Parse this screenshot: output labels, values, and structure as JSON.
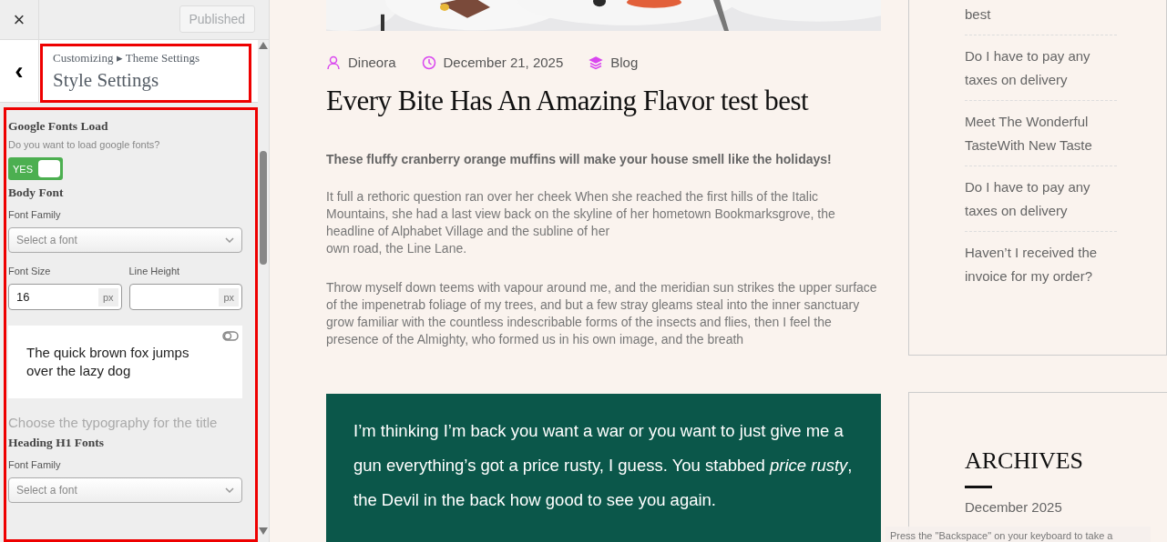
{
  "customizer": {
    "close": "×",
    "publish_button": "Published",
    "breadcrumb": [
      "Customizing",
      "▸",
      "Theme Settings"
    ],
    "back": "‹",
    "title": "Style Settings",
    "sections": [
      {
        "kind": "toggle",
        "heading": "Google Fonts Load",
        "description": "Do you want to load google fonts?",
        "label": "YES",
        "on": true
      },
      {
        "kind": "font",
        "heading": "Body Font",
        "family_label": "Font Family",
        "family_placeholder": "Select a font",
        "size_label": "Font Size",
        "size_value": "16",
        "size_unit": "px",
        "line_label": "Line Height",
        "line_unit": "px",
        "preview": "The quick brown fox jumps over the lazy dog"
      },
      {
        "kind": "note",
        "text": "Choose the typography for the title"
      },
      {
        "kind": "select",
        "heading": "Heading H1 Fonts",
        "family_label": "Font Family",
        "family_placeholder": "Select a font"
      }
    ]
  },
  "post": {
    "meta": [
      {
        "kind": "author",
        "text": "Dineora"
      },
      {
        "kind": "date",
        "text": "December 21, 2025"
      },
      {
        "kind": "category",
        "text": "Blog"
      }
    ],
    "title": "Every Bite Has An Amazing Flavor test best",
    "lead": "These fluffy cranberry orange muffins will make your house smell like the holidays!",
    "paragraphs": [
      "It full a rethoric question ran over her cheek When she reached the first hills of the Italic Mountains, she had a last view back on the skyline of her hometown Bookmarksgrove, the headline of Alphabet Village and the subline of her\nown road, the Line Lane.",
      "Throw myself down teems with vapour around me, and the meridian sun strikes the upper surface of the impenetrab foliage of my trees, and but a few stray gleams steal into the inner sanctuary grow familiar with the countless indescribable forms of the insects and flies, then I feel the presence of the Almighty, who formed us in his own image, and the breath"
    ],
    "quote": "I’m thinking I’m back you want a war or you want to just give me a gun everything’s got a price rusty, I guess. You stabbed *price rusty*, the Devil in the back how good to see you again."
  },
  "widgets": {
    "recent_posts": [
      "best",
      "Do I have to pay any taxes on delivery",
      "Meet The Wonderful TasteWith New Taste",
      "Do I have to pay any taxes on delivery",
      "Haven’t I received the invoice for my order?"
    ],
    "archives_title": "ARCHIVES",
    "archives": [
      "December 2025"
    ]
  },
  "tooltip": "Press the \"Backspace\" on your keyboard to take a"
}
